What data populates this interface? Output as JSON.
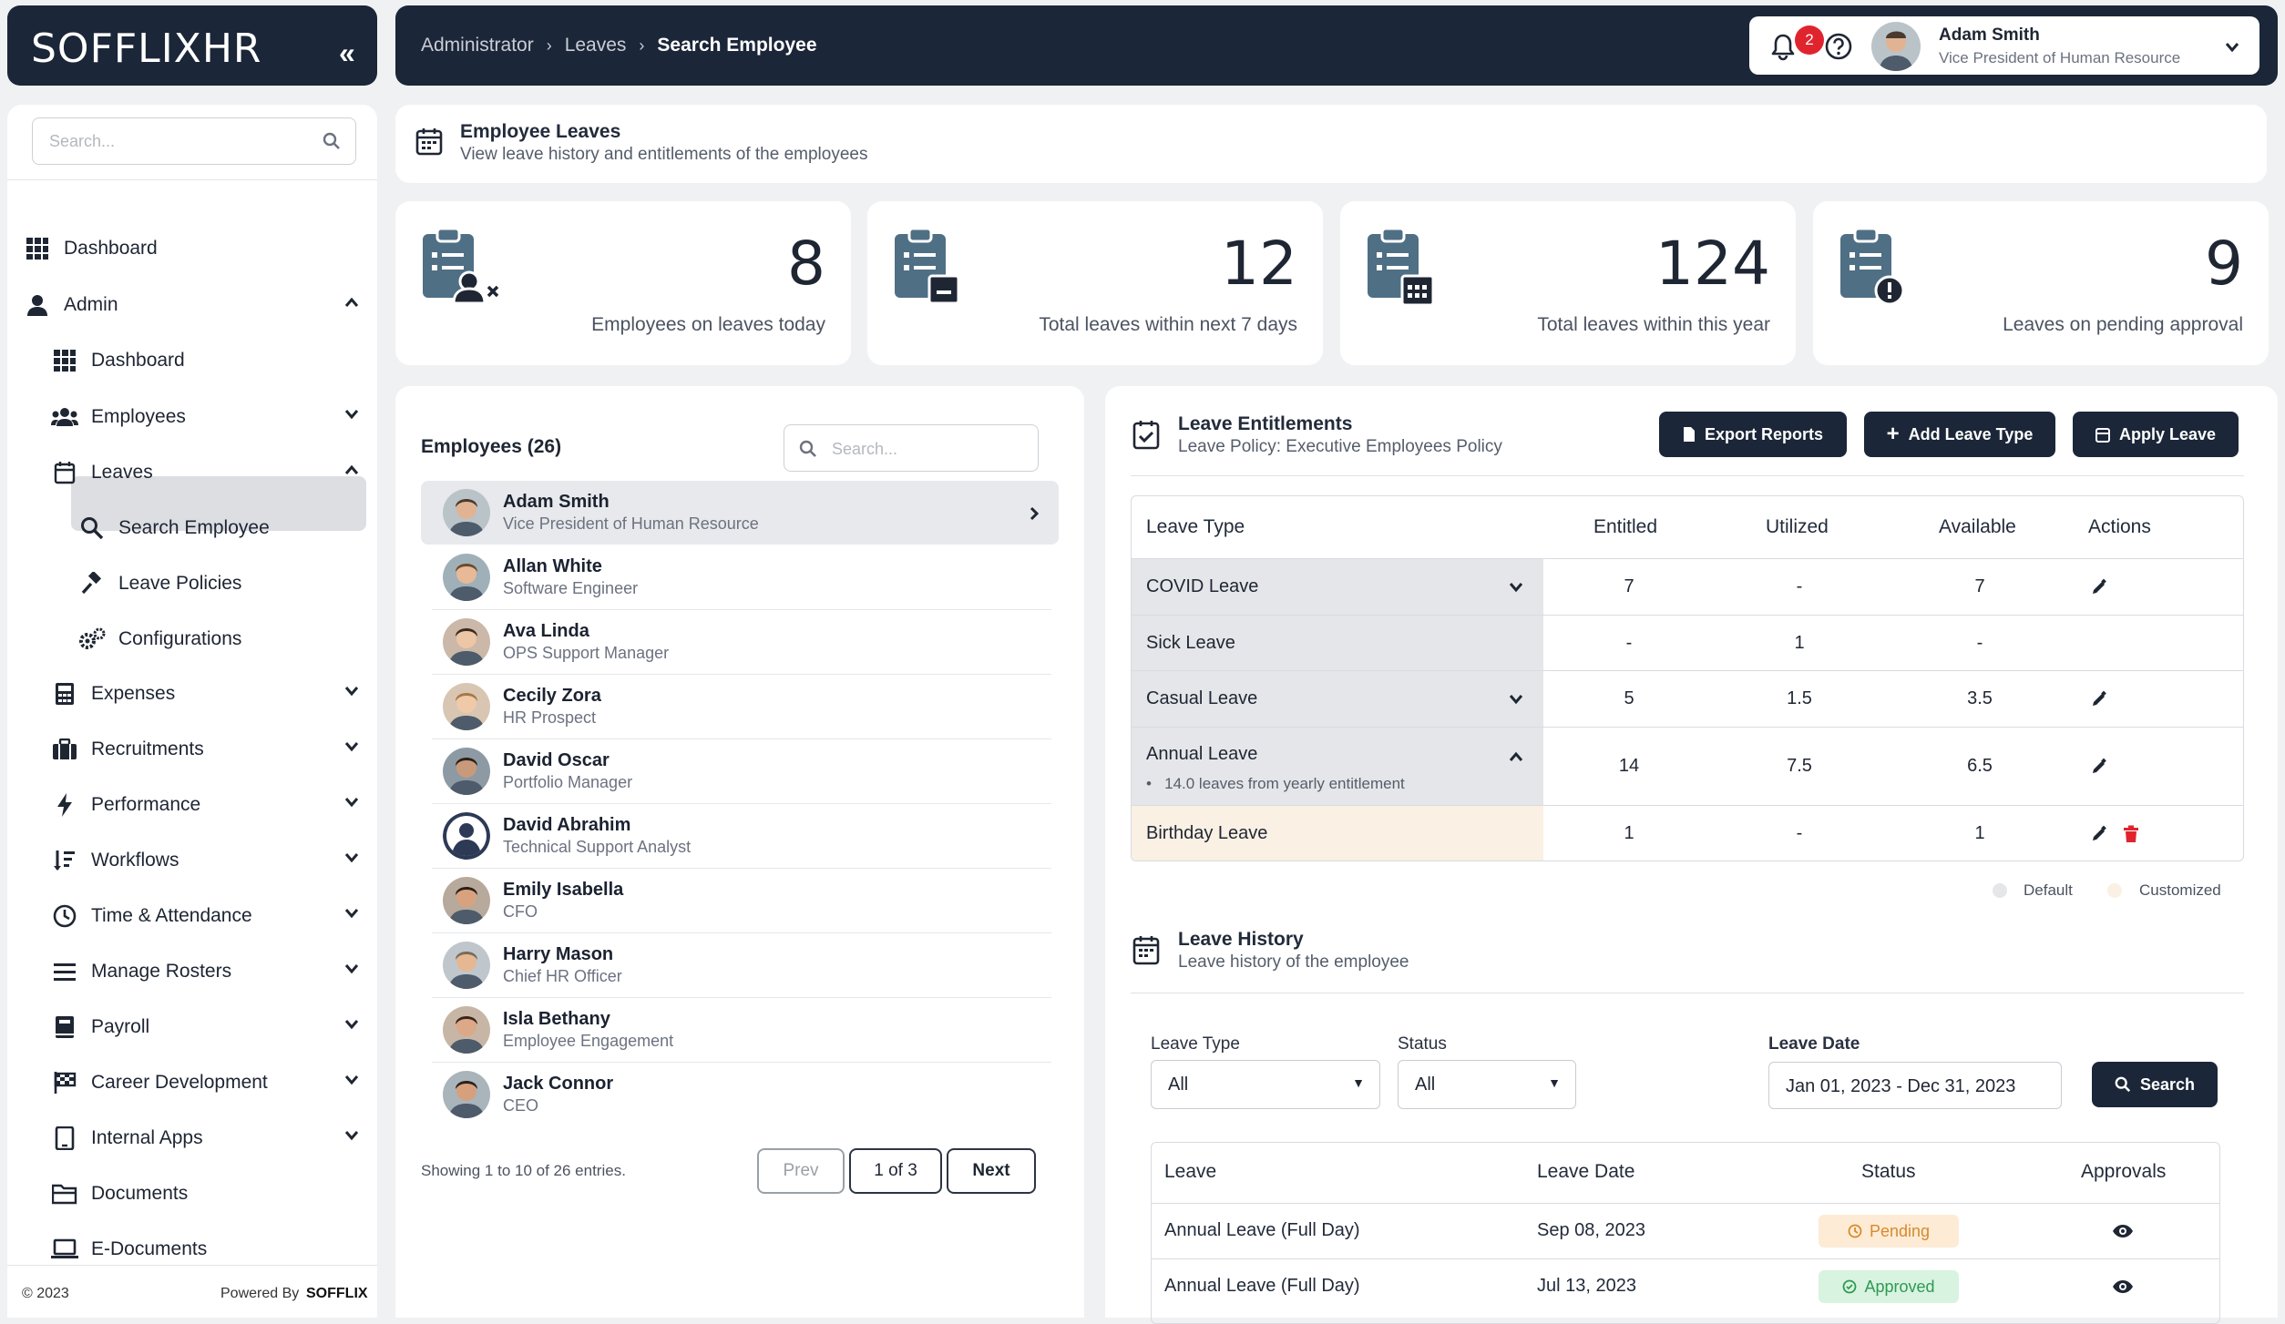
{
  "brand": {
    "logo": "SOFFLIXHR",
    "collapse_icon": "double-chevron-left-icon"
  },
  "sidebar": {
    "search_placeholder": "Search...",
    "items": [
      {
        "label": "Dashboard",
        "icon": "grid-icon"
      },
      {
        "label": "Admin",
        "icon": "user-icon"
      },
      {
        "label": "Dashboard",
        "icon": "grid-icon"
      },
      {
        "label": "Employees",
        "icon": "users-icon"
      },
      {
        "label": "Leaves",
        "icon": "calendar-icon"
      },
      {
        "label": "Search Employee",
        "icon": "search-icon"
      },
      {
        "label": "Leave Policies",
        "icon": "gavel-icon"
      },
      {
        "label": "Configurations",
        "icon": "gears-icon"
      },
      {
        "label": "Expenses",
        "icon": "calculator-icon"
      },
      {
        "label": "Recruitments",
        "icon": "briefcase-icon"
      },
      {
        "label": "Performance",
        "icon": "bolt-icon"
      },
      {
        "label": "Workflows",
        "icon": "sort-icon"
      },
      {
        "label": "Time & Attendance",
        "icon": "clock-icon"
      },
      {
        "label": "Manage Rosters",
        "icon": "list-icon"
      },
      {
        "label": "Payroll",
        "icon": "book-icon"
      },
      {
        "label": "Career Development",
        "icon": "flag-icon"
      },
      {
        "label": "Internal Apps",
        "icon": "tablet-icon"
      },
      {
        "label": "Documents",
        "icon": "folder-icon"
      },
      {
        "label": "E-Documents",
        "icon": "laptop-icon"
      }
    ],
    "footer": {
      "copyright": "© 2023",
      "powered_by": "Powered By",
      "powered_brand": "SOFFLIX"
    }
  },
  "header": {
    "breadcrumb": [
      "Administrator",
      "Leaves",
      "Search Employee"
    ],
    "notification_count": "2",
    "user": {
      "name": "Adam Smith",
      "title": "Vice President of Human Resource"
    }
  },
  "page": {
    "title": "Employee Leaves",
    "subtitle": "View leave history and entitlements of the employees"
  },
  "stats": [
    {
      "value": "8",
      "label": "Employees on leaves today",
      "icon": "clipboard-user-icon"
    },
    {
      "value": "12",
      "label": "Total leaves within next 7 days",
      "icon": "clipboard-calendar-icon"
    },
    {
      "value": "124",
      "label": "Total leaves within this year",
      "icon": "clipboard-calendar-grid-icon"
    },
    {
      "value": "9",
      "label": "Leaves on pending approval",
      "icon": "clipboard-alert-icon"
    }
  ],
  "employees": {
    "title": "Employees (26)",
    "search_placeholder": "Search...",
    "list": [
      {
        "name": "Adam Smith",
        "role": "Vice President of Human Resource"
      },
      {
        "name": "Allan White",
        "role": "Software Engineer"
      },
      {
        "name": "Ava Linda",
        "role": "OPS Support Manager"
      },
      {
        "name": "Cecily Zora",
        "role": "HR Prospect"
      },
      {
        "name": "David Oscar",
        "role": "Portfolio Manager"
      },
      {
        "name": "David Abrahim",
        "role": "Technical Support Analyst"
      },
      {
        "name": "Emily Isabella",
        "role": "CFO"
      },
      {
        "name": "Harry Mason",
        "role": "Chief HR Officer"
      },
      {
        "name": "Isla Bethany",
        "role": "Employee Engagement"
      },
      {
        "name": "Jack Connor",
        "role": "CEO"
      }
    ],
    "showing": "Showing 1 to 10 of 26 entries.",
    "pagination": {
      "prev": "Prev",
      "current": "1 of 3",
      "next": "Next"
    }
  },
  "entitlements": {
    "title": "Leave Entitlements",
    "policy": "Leave Policy: Executive Employees Policy",
    "buttons": {
      "export": "Export Reports",
      "add": "Add Leave Type",
      "apply": "Apply Leave"
    },
    "columns": [
      "Leave Type",
      "Entitled",
      "Utilized",
      "Available",
      "Actions"
    ],
    "rows": [
      {
        "type": "COVID Leave",
        "entitled": "7",
        "utilized": "-",
        "available": "7"
      },
      {
        "type": "Sick Leave",
        "entitled": "-",
        "utilized": "1",
        "available": "-"
      },
      {
        "type": "Casual Leave",
        "entitled": "5",
        "utilized": "1.5",
        "available": "3.5"
      },
      {
        "type": "Annual Leave",
        "entitled": "14",
        "utilized": "7.5",
        "available": "6.5",
        "note": "14.0 leaves from yearly entitlement"
      },
      {
        "type": "Birthday Leave",
        "entitled": "1",
        "utilized": "-",
        "available": "1"
      }
    ],
    "legend": {
      "default": "Default",
      "customized": "Customized"
    },
    "colors": {
      "default_row": "#e5e6e9",
      "customized_row": "#faf0e3",
      "delete": "#e0242e"
    }
  },
  "history": {
    "title": "Leave History",
    "subtitle": "Leave history of the employee",
    "filters": {
      "leave_type_label": "Leave Type",
      "leave_type_value": "All",
      "status_label": "Status",
      "status_value": "All",
      "date_label": "Leave Date",
      "date_value": "Jan 01, 2023 - Dec 31, 2023",
      "search_button": "Search"
    },
    "columns": [
      "Leave",
      "Leave Date",
      "Status",
      "Approvals"
    ],
    "rows": [
      {
        "leave": "Annual Leave (Full Day)",
        "date": "Sep 08, 2023",
        "status": "Pending"
      },
      {
        "leave": "Annual Leave (Full Day)",
        "date": "Jul 13, 2023",
        "status": "Approved"
      }
    ],
    "colors": {
      "pending_bg": "#fdebd6",
      "pending_fg": "#d88a2c",
      "approved_bg": "#d9f3e1",
      "approved_fg": "#2e9a52"
    }
  }
}
